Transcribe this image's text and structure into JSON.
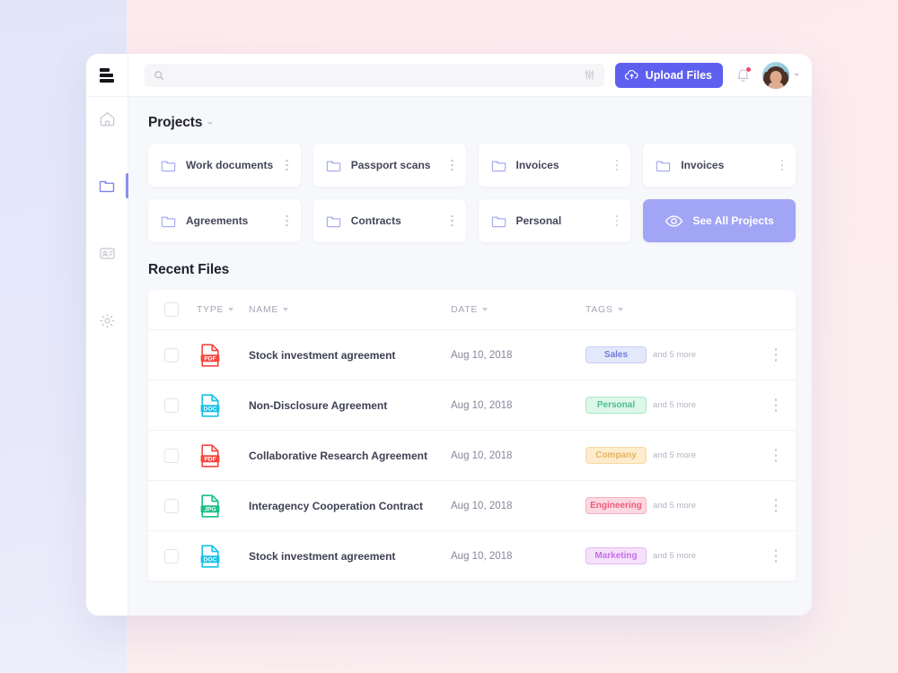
{
  "window": {
    "sidebar": {
      "menu_icon": "hamburger-icon",
      "items": [
        {
          "icon": "home-icon",
          "name": "home",
          "active": false
        },
        {
          "icon": "folder-icon",
          "name": "files",
          "active": true
        },
        {
          "icon": "id-card-icon",
          "name": "contacts",
          "active": false
        },
        {
          "icon": "gear-icon",
          "name": "settings",
          "active": false
        }
      ]
    },
    "topbar": {
      "search": {
        "value": "",
        "placeholder": "",
        "icon": "search-icon",
        "filter_icon": "filter-sliders-icon"
      },
      "upload_button": {
        "label": "Upload Files",
        "icon": "cloud-upload-icon",
        "color": "#5d5fef"
      },
      "notifications": {
        "icon": "bell-icon",
        "has_badge": true,
        "badge_color": "#f0456b"
      },
      "account": {
        "avatar": "user-avatar",
        "caret": "chevron-down-icon"
      }
    },
    "projects": {
      "title": "Projects",
      "cards": [
        {
          "label": "Work documents"
        },
        {
          "label": "Passport scans"
        },
        {
          "label": "Invoices"
        },
        {
          "label": "Invoices"
        },
        {
          "label": "Agreements"
        },
        {
          "label": "Contracts"
        },
        {
          "label": "Personal"
        }
      ],
      "see_all_button": {
        "label": "See All Projects",
        "icon": "eye-icon",
        "color": "#a2a5f5"
      }
    },
    "recent_files": {
      "title": "Recent Files",
      "columns": [
        {
          "label": "TYPE"
        },
        {
          "label": "NAME"
        },
        {
          "label": "DATE"
        },
        {
          "label": "TAGS"
        }
      ],
      "rows": [
        {
          "type": "PDF",
          "type_color": "#f4463f",
          "name": "Stock investment agreement",
          "date": "Aug 10, 2018",
          "tag": "Sales",
          "tag_text_color": "#6f7bd8",
          "tag_bg": "#e4e8fb",
          "tag_border": "#c8cef5",
          "more": "and 5 more"
        },
        {
          "type": "DOC",
          "type_color": "#17c1e8",
          "name": "Non-Disclosure Agreement",
          "date": "Aug 10, 2018",
          "tag": "Personal",
          "tag_text_color": "#4fc08d",
          "tag_bg": "#ddf7e9",
          "tag_border": "#a8e8c6",
          "more": "and 5 more"
        },
        {
          "type": "PDF",
          "type_color": "#f4463f",
          "name": "Collaborative Research Agreement",
          "date": "Aug 10, 2018",
          "tag": "Company",
          "tag_text_color": "#e8b45e",
          "tag_bg": "#fdeccd",
          "tag_border": "#f7d9a4",
          "more": "and 5 more"
        },
        {
          "type": "JPG",
          "type_color": "#18bf8a",
          "name": "Interagency Cooperation Contract",
          "date": "Aug 10, 2018",
          "tag": "Engineering",
          "tag_text_color": "#ef5b7d",
          "tag_bg": "#fcd9e1",
          "tag_border": "#f6aebf",
          "more": "and 5 more"
        },
        {
          "type": "DOC",
          "type_color": "#17c1e8",
          "name": "Stock investment agreement",
          "date": "Aug 10, 2018",
          "tag": "Marketing",
          "tag_text_color": "#c470e8",
          "tag_bg": "#f6e1fb",
          "tag_border": "#e6b8f5",
          "more": "and 5 more"
        }
      ]
    }
  }
}
